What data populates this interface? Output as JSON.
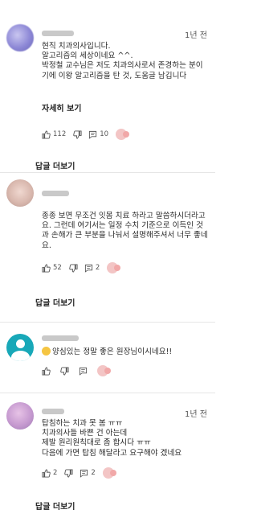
{
  "comments": [
    {
      "time": "1년 전",
      "lines": [
        "현직 치과의사입니다.",
        "알고리즘의 세상이네요 ^^.",
        "박정철 교수님은 저도 치과의사로서 존경하는 분이",
        "기에 이왕 알고리즘을 탄 것, 도움글 남깁니다"
      ],
      "more_label": "자세히 보기",
      "likes": "112",
      "replies_count": "10",
      "replies_label": "답글 더보기"
    },
    {
      "time": "",
      "lines": [
        "종종 보면 무조건 잇몸 치료 하라고 말씀하시더라고",
        "요. 그런데 여기서는 일정 수치 기준으로 이득인 것",
        "과 손해가 큰 부분을 나눠서 설명해주셔서 너무 좋네",
        "요."
      ],
      "likes": "52",
      "replies_count": "2",
      "replies_label": "답글 더보기"
    },
    {
      "time": "",
      "lines": [
        "양심있는 정말 좋은 원장님이시네요!!"
      ],
      "likes": "",
      "replies_count": ""
    },
    {
      "time": "1년 전",
      "lines": [
        "탑침하는 치과 못 봄 ㅠㅠ",
        "치과의사들 바쁜 건 아는데",
        "제발 원리원칙대로 좀 합시다 ㅠㅠ",
        "다음에 가면 탑침 해달라고 요구해야 겠네요"
      ],
      "likes": "2",
      "replies_count": "2",
      "replies_label": "답글 더보기"
    }
  ],
  "icons": {
    "like": "thumbs-up-icon",
    "dislike": "thumbs-down-icon",
    "reply": "comment-icon",
    "emoji": "emoji-reaction-icon"
  },
  "colors": {
    "avatar_1": "#8d88d6",
    "avatar_3": "#18a8b8",
    "avatar_4": "#c69ad0",
    "emoji": "#f3c5c5"
  }
}
